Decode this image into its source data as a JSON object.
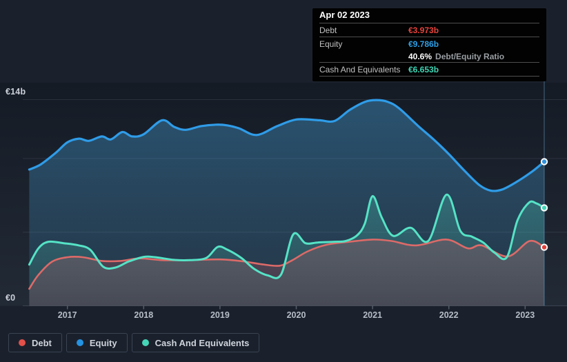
{
  "tooltip": {
    "date": "Apr 02 2023",
    "debt": {
      "label": "Debt",
      "value": "€3.973b"
    },
    "equity": {
      "label": "Equity",
      "value": "€9.786b"
    },
    "ratio": {
      "pct": "40.6%",
      "text": "Debt/Equity Ratio"
    },
    "cash": {
      "label": "Cash And Equivalents",
      "value": "€6.653b"
    }
  },
  "y_axis": {
    "top_label": "€14b",
    "zero_label": "€0"
  },
  "legend": [
    {
      "label": "Debt",
      "color": "#e2504a"
    },
    {
      "label": "Equity",
      "color": "#2493e2"
    },
    {
      "label": "Cash And Equivalents",
      "color": "#45d6b8"
    }
  ],
  "colors": {
    "debt_value": "#e8433c",
    "equity_value": "#2e9fe8",
    "cash_value": "#3fd6b5",
    "background": "#1b212c",
    "tooltip_bg": "#020202"
  },
  "chart_data": {
    "type": "area",
    "title": "",
    "x_axis": {
      "unit": "year",
      "ticks": [
        2017,
        2018,
        2019,
        2020,
        2021,
        2022,
        2023
      ]
    },
    "y_axis": {
      "min": 0,
      "max": 14,
      "unit": "billions EUR",
      "gridline_values": [
        14,
        10,
        5
      ],
      "labeled": {
        "14": "€14b",
        "0": "€0"
      }
    },
    "legend_position": "bottom-left",
    "grid": true,
    "crosshair_x": 2023.25,
    "series": [
      {
        "name": "Debt",
        "line_color": "#dd6a68",
        "marker_color": "#e2403a",
        "fill_top": "rgba(222,92,98,0.40)",
        "fill_bottom": "rgba(222,92,98,0.16)",
        "points": [
          [
            2016.5,
            1.15
          ],
          [
            2016.62,
            2.1
          ],
          [
            2016.8,
            3.0
          ],
          [
            2017.0,
            3.3
          ],
          [
            2017.2,
            3.3
          ],
          [
            2017.45,
            3.05
          ],
          [
            2017.7,
            3.05
          ],
          [
            2017.95,
            3.22
          ],
          [
            2018.25,
            3.1
          ],
          [
            2018.6,
            3.1
          ],
          [
            2019.0,
            3.15
          ],
          [
            2019.3,
            3.02
          ],
          [
            2019.55,
            2.82
          ],
          [
            2019.78,
            2.72
          ],
          [
            2019.95,
            3.1
          ],
          [
            2020.15,
            3.7
          ],
          [
            2020.4,
            4.15
          ],
          [
            2020.7,
            4.35
          ],
          [
            2021.0,
            4.5
          ],
          [
            2021.25,
            4.4
          ],
          [
            2021.57,
            4.1
          ],
          [
            2021.97,
            4.5
          ],
          [
            2022.25,
            3.9
          ],
          [
            2022.43,
            4.1
          ],
          [
            2022.77,
            3.35
          ],
          [
            2023.06,
            4.4
          ],
          [
            2023.25,
            3.973
          ]
        ]
      },
      {
        "name": "Equity",
        "line_color": "#2f9ce8",
        "marker_color": "#2e93e0",
        "fill_top": "rgba(70,160,215,0.42)",
        "fill_bottom": "rgba(70,160,215,0.10)",
        "points": [
          [
            2016.5,
            9.25
          ],
          [
            2016.65,
            9.6
          ],
          [
            2016.85,
            10.4
          ],
          [
            2017.0,
            11.1
          ],
          [
            2017.15,
            11.35
          ],
          [
            2017.28,
            11.2
          ],
          [
            2017.45,
            11.5
          ],
          [
            2017.57,
            11.3
          ],
          [
            2017.72,
            11.8
          ],
          [
            2017.85,
            11.5
          ],
          [
            2018.0,
            11.65
          ],
          [
            2018.24,
            12.6
          ],
          [
            2018.4,
            12.15
          ],
          [
            2018.55,
            11.95
          ],
          [
            2018.75,
            12.2
          ],
          [
            2018.95,
            12.3
          ],
          [
            2019.1,
            12.25
          ],
          [
            2019.25,
            12.05
          ],
          [
            2019.48,
            11.6
          ],
          [
            2019.75,
            12.2
          ],
          [
            2020.0,
            12.65
          ],
          [
            2020.3,
            12.6
          ],
          [
            2020.5,
            12.55
          ],
          [
            2020.7,
            13.3
          ],
          [
            2020.9,
            13.85
          ],
          [
            2021.05,
            13.97
          ],
          [
            2021.2,
            13.85
          ],
          [
            2021.35,
            13.4
          ],
          [
            2021.6,
            12.2
          ],
          [
            2021.8,
            11.3
          ],
          [
            2022.0,
            10.3
          ],
          [
            2022.2,
            9.2
          ],
          [
            2022.4,
            8.2
          ],
          [
            2022.55,
            7.82
          ],
          [
            2022.7,
            7.9
          ],
          [
            2022.9,
            8.45
          ],
          [
            2023.1,
            9.15
          ],
          [
            2023.25,
            9.786
          ]
        ]
      },
      {
        "name": "Cash And Equivalents",
        "line_color": "#55e3c6",
        "marker_color": "#43d6b8",
        "fill_top": "rgba(78,216,190,0.42)",
        "fill_bottom": "rgba(78,216,190,0.10)",
        "points": [
          [
            2016.5,
            2.8
          ],
          [
            2016.62,
            3.9
          ],
          [
            2016.75,
            4.35
          ],
          [
            2016.95,
            4.25
          ],
          [
            2017.15,
            4.1
          ],
          [
            2017.3,
            3.8
          ],
          [
            2017.47,
            2.65
          ],
          [
            2017.63,
            2.6
          ],
          [
            2017.8,
            3.0
          ],
          [
            2018.0,
            3.32
          ],
          [
            2018.15,
            3.3
          ],
          [
            2018.4,
            3.12
          ],
          [
            2018.6,
            3.1
          ],
          [
            2018.82,
            3.25
          ],
          [
            2018.97,
            4.0
          ],
          [
            2019.1,
            3.8
          ],
          [
            2019.28,
            3.25
          ],
          [
            2019.45,
            2.5
          ],
          [
            2019.63,
            2.06
          ],
          [
            2019.8,
            2.12
          ],
          [
            2019.96,
            4.85
          ],
          [
            2020.12,
            4.25
          ],
          [
            2020.28,
            4.3
          ],
          [
            2020.5,
            4.35
          ],
          [
            2020.65,
            4.4
          ],
          [
            2020.8,
            4.8
          ],
          [
            2020.9,
            5.6
          ],
          [
            2021.0,
            7.45
          ],
          [
            2021.12,
            6.0
          ],
          [
            2021.27,
            4.75
          ],
          [
            2021.5,
            5.3
          ],
          [
            2021.73,
            4.4
          ],
          [
            2021.97,
            7.55
          ],
          [
            2022.15,
            5.1
          ],
          [
            2022.3,
            4.7
          ],
          [
            2022.45,
            4.3
          ],
          [
            2022.6,
            3.6
          ],
          [
            2022.76,
            3.3
          ],
          [
            2022.9,
            5.8
          ],
          [
            2023.05,
            7.0
          ],
          [
            2023.15,
            6.95
          ],
          [
            2023.25,
            6.653
          ]
        ]
      }
    ]
  }
}
